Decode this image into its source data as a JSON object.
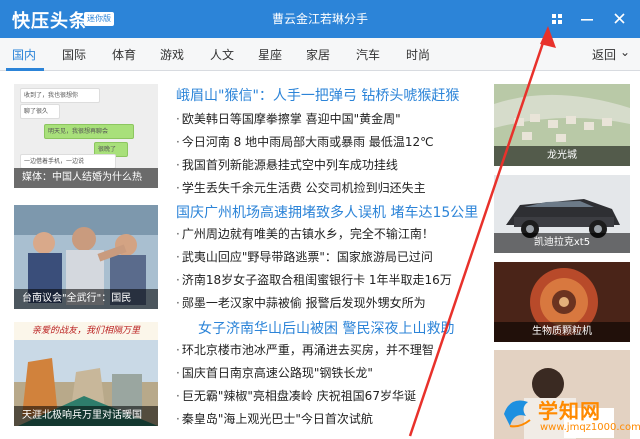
{
  "titlebar": {
    "logo": "快压头条",
    "badge": "迷你版",
    "title": "曹云金江若琳分手"
  },
  "nav": {
    "items": [
      "国内",
      "国际",
      "体育",
      "游戏",
      "人文",
      "星座",
      "家居",
      "汽车",
      "时尚"
    ],
    "back_label": "返回",
    "back_glyph": "⌄"
  },
  "left_thumbs": [
    {
      "caption": "媒体：中国人结婚为什么热",
      "chat_lines": [
        "收到了，我也很想你",
        "聊了很久",
        "明天见，我很想再聊会",
        "很晚了",
        "一边借着手机，一边说"
      ]
    },
    {
      "caption": "台南议会\"全武行\"：国民"
    },
    {
      "caption": "天涯北极响兵万里对话暖国",
      "banner": "亲爱的战友，我们相隔万里"
    }
  ],
  "news": [
    {
      "text": "峨眉山\"猴信\"：人手一把弹弓 钻桥头唬猴赶猴",
      "head": true
    },
    {
      "text": "欧美韩日等国摩拳擦掌 喜迎中国\"黄金周\"",
      "head": false
    },
    {
      "text": "今日河南 8 地中雨局部大雨或暴雨 最低温12℃",
      "head": false
    },
    {
      "text": "我国首列新能源悬挂式空中列车成功挂线",
      "head": false
    },
    {
      "text": "学生丢失千余元生活费 公交司机捡到归还失主",
      "head": false
    },
    {
      "text": "国庆广州机场高速拥堵致多人误机 堵车达15公里",
      "head": true
    },
    {
      "text": "广州周边就有唯美的古镇水乡，完全不输江南！",
      "head": false
    },
    {
      "text": "武夷山回应\"野导带路逃票\"：国家旅游局已过问",
      "head": false
    },
    {
      "text": "济南18岁女子盗取合租闺蜜银行卡 1年半取走16万",
      "head": false
    },
    {
      "text": "郧墨一老汉家中蒜被偷 报警后发现外甥女所为",
      "head": false
    },
    {
      "text": "女子济南华山后山被困 警民深夜上山救助",
      "head": true
    },
    {
      "text": "环北京楼市池冰严重，再涌进去买房，并不理智",
      "head": false
    },
    {
      "text": "国庆首日南京高速公路现\"钢铁长龙\"",
      "head": false
    },
    {
      "text": "巨无霸\"辣椒\"亮相盘凑岭 庆祝祖国67岁华诞",
      "head": false
    },
    {
      "text": "秦皇岛\"海上观光巴士\"今日首次试航",
      "head": false
    }
  ],
  "right_thumbs": [
    {
      "caption": "龙光城"
    },
    {
      "caption": "凯迪拉克xt5"
    },
    {
      "caption": "生物质颗粒机"
    },
    {
      "caption": ""
    }
  ],
  "watermark": {
    "text": "学知网",
    "url": "www.jmqz1000.com"
  },
  "colors": {
    "brand": "#2c84d8",
    "annotation_arrow": "#e8312b",
    "watermark": "#ff8a00"
  }
}
